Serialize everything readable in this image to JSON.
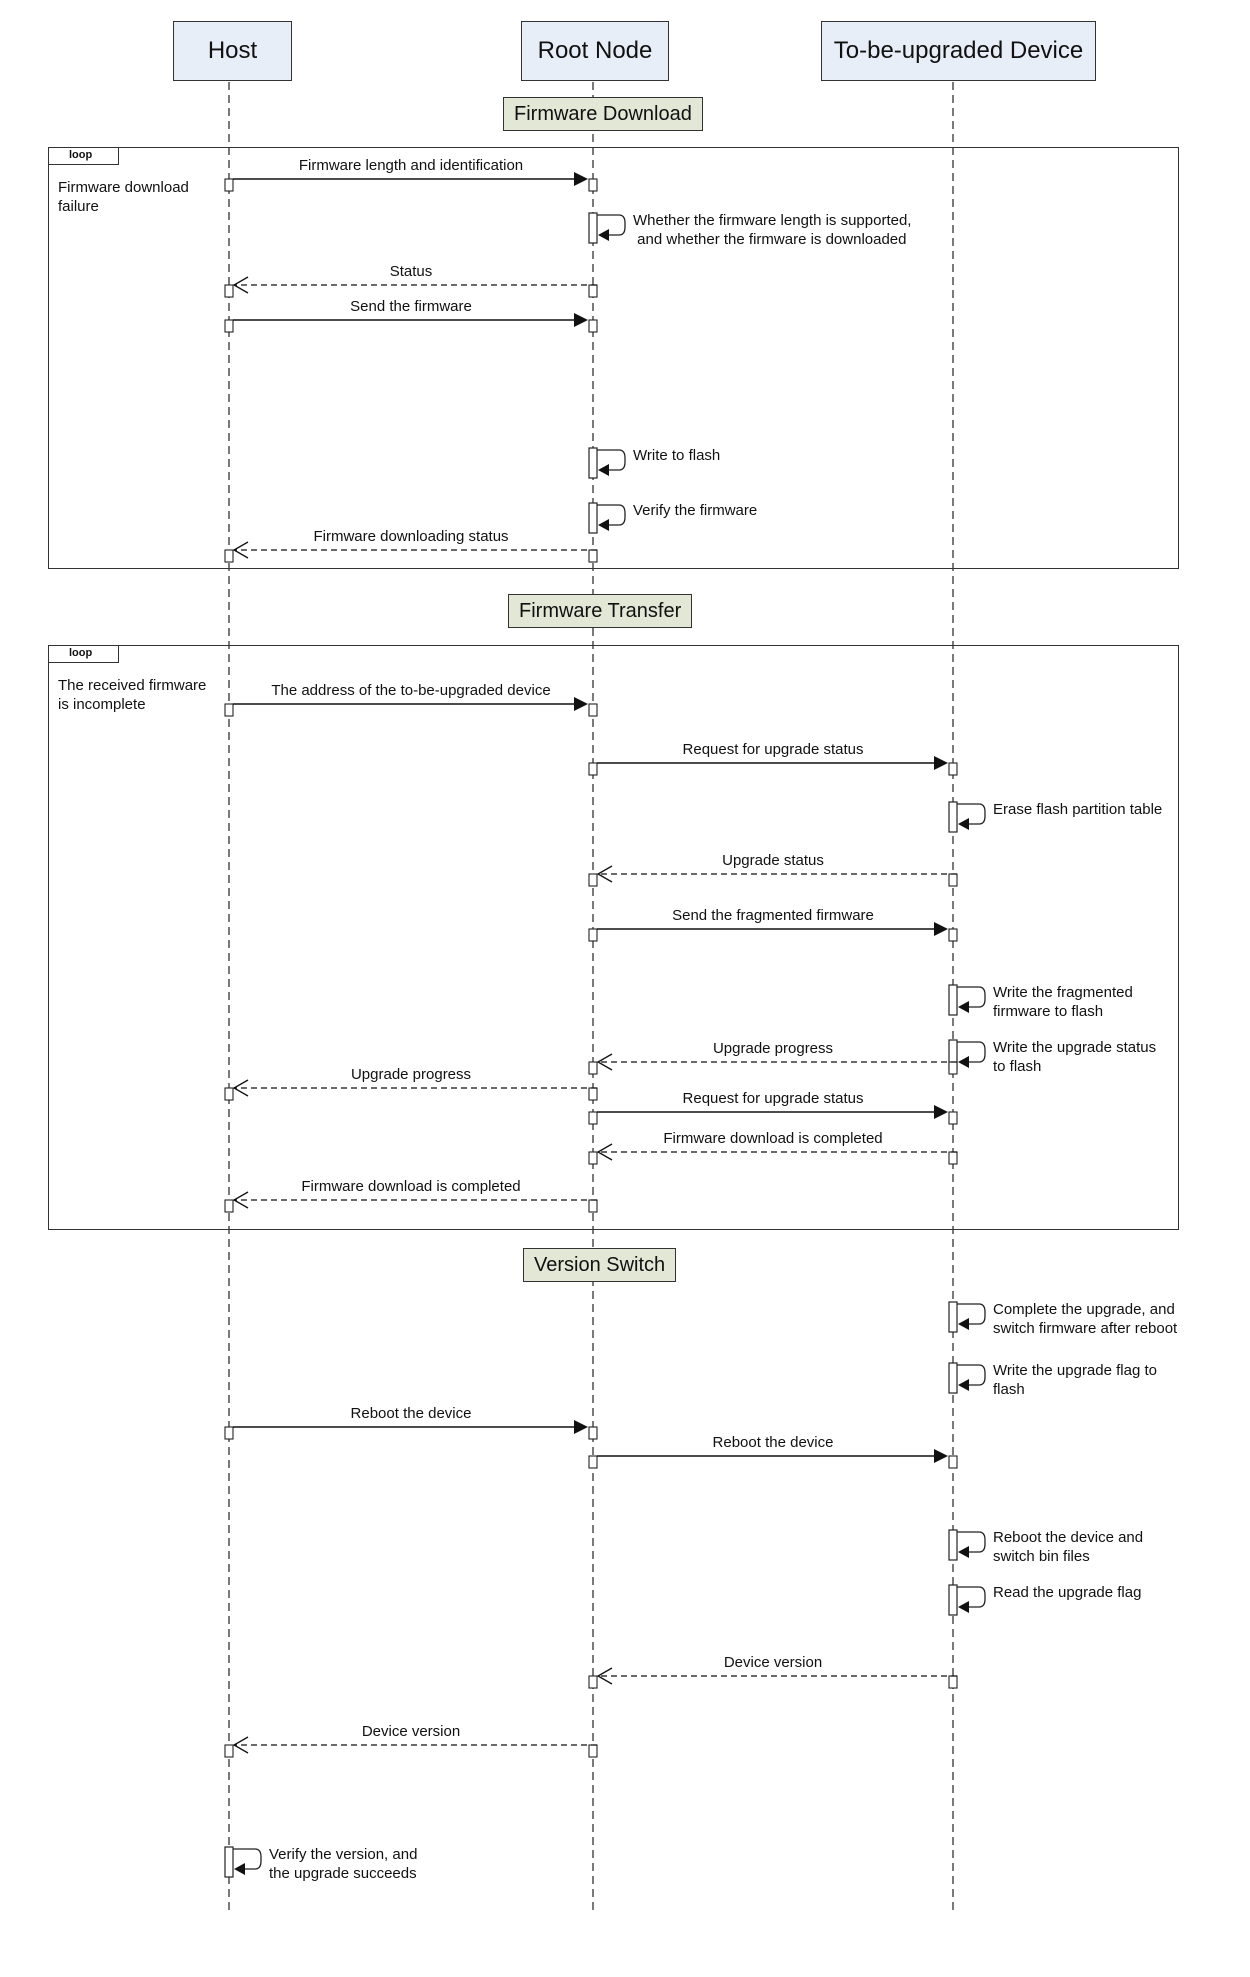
{
  "participants": [
    {
      "id": "host",
      "label": "Host"
    },
    {
      "id": "root",
      "label": "Root Node"
    },
    {
      "id": "device",
      "label": "To-be-upgraded Device"
    }
  ],
  "sections": [
    {
      "label": "Firmware Download"
    },
    {
      "label": "Firmware Transfer"
    },
    {
      "label": "Version Switch"
    }
  ],
  "frames": [
    {
      "tag": "loop",
      "guard": "Firmware download\nfailure"
    },
    {
      "tag": "loop",
      "guard": "The received firmware\nis incomplete"
    }
  ],
  "messages": [
    {
      "from": "host",
      "to": "root",
      "type": "sync",
      "label": "Firmware length and identification"
    },
    {
      "from": "root",
      "to": "root",
      "type": "self",
      "label": "Whether the firmware length is supported,\n and whether the firmware is downloaded"
    },
    {
      "from": "root",
      "to": "host",
      "type": "reply",
      "label": "Status"
    },
    {
      "from": "host",
      "to": "root",
      "type": "sync",
      "label": "Send the firmware"
    },
    {
      "from": "root",
      "to": "root",
      "type": "self",
      "label": "Write to flash"
    },
    {
      "from": "root",
      "to": "root",
      "type": "self",
      "label": "Verify the firmware"
    },
    {
      "from": "root",
      "to": "host",
      "type": "reply",
      "label": "Firmware downloading status"
    },
    {
      "from": "host",
      "to": "root",
      "type": "sync",
      "label": "The address of the to-be-upgraded device"
    },
    {
      "from": "root",
      "to": "device",
      "type": "sync",
      "label": "Request for upgrade status"
    },
    {
      "from": "device",
      "to": "device",
      "type": "self",
      "label": "Erase flash partition table"
    },
    {
      "from": "device",
      "to": "root",
      "type": "reply",
      "label": "Upgrade status"
    },
    {
      "from": "root",
      "to": "device",
      "type": "sync",
      "label": "Send the fragmented firmware"
    },
    {
      "from": "device",
      "to": "device",
      "type": "self",
      "label": "Write the fragmented\nfirmware to flash"
    },
    {
      "from": "device",
      "to": "device",
      "type": "self",
      "label": "Write the upgrade status\nto flash"
    },
    {
      "from": "device",
      "to": "root",
      "type": "reply",
      "label": "Upgrade progress"
    },
    {
      "from": "root",
      "to": "host",
      "type": "reply",
      "label": "Upgrade progress"
    },
    {
      "from": "root",
      "to": "device",
      "type": "sync",
      "label": "Request for upgrade status"
    },
    {
      "from": "device",
      "to": "root",
      "type": "reply",
      "label": "Firmware download is completed"
    },
    {
      "from": "root",
      "to": "host",
      "type": "reply",
      "label": "Firmware download is completed"
    },
    {
      "from": "device",
      "to": "device",
      "type": "self",
      "label": "Complete the upgrade, and\nswitch firmware after reboot"
    },
    {
      "from": "device",
      "to": "device",
      "type": "self",
      "label": "Write the upgrade flag to\nflash"
    },
    {
      "from": "host",
      "to": "root",
      "type": "sync",
      "label": "Reboot the device"
    },
    {
      "from": "root",
      "to": "device",
      "type": "sync",
      "label": "Reboot the device"
    },
    {
      "from": "device",
      "to": "device",
      "type": "self",
      "label": "Reboot the device and\nswitch bin files"
    },
    {
      "from": "device",
      "to": "device",
      "type": "self",
      "label": "Read the upgrade flag"
    },
    {
      "from": "device",
      "to": "root",
      "type": "reply",
      "label": "Device version"
    },
    {
      "from": "root",
      "to": "host",
      "type": "reply",
      "label": "Device version"
    },
    {
      "from": "host",
      "to": "host",
      "type": "self",
      "label": "Verify the version, and\nthe upgrade succeeds"
    }
  ]
}
